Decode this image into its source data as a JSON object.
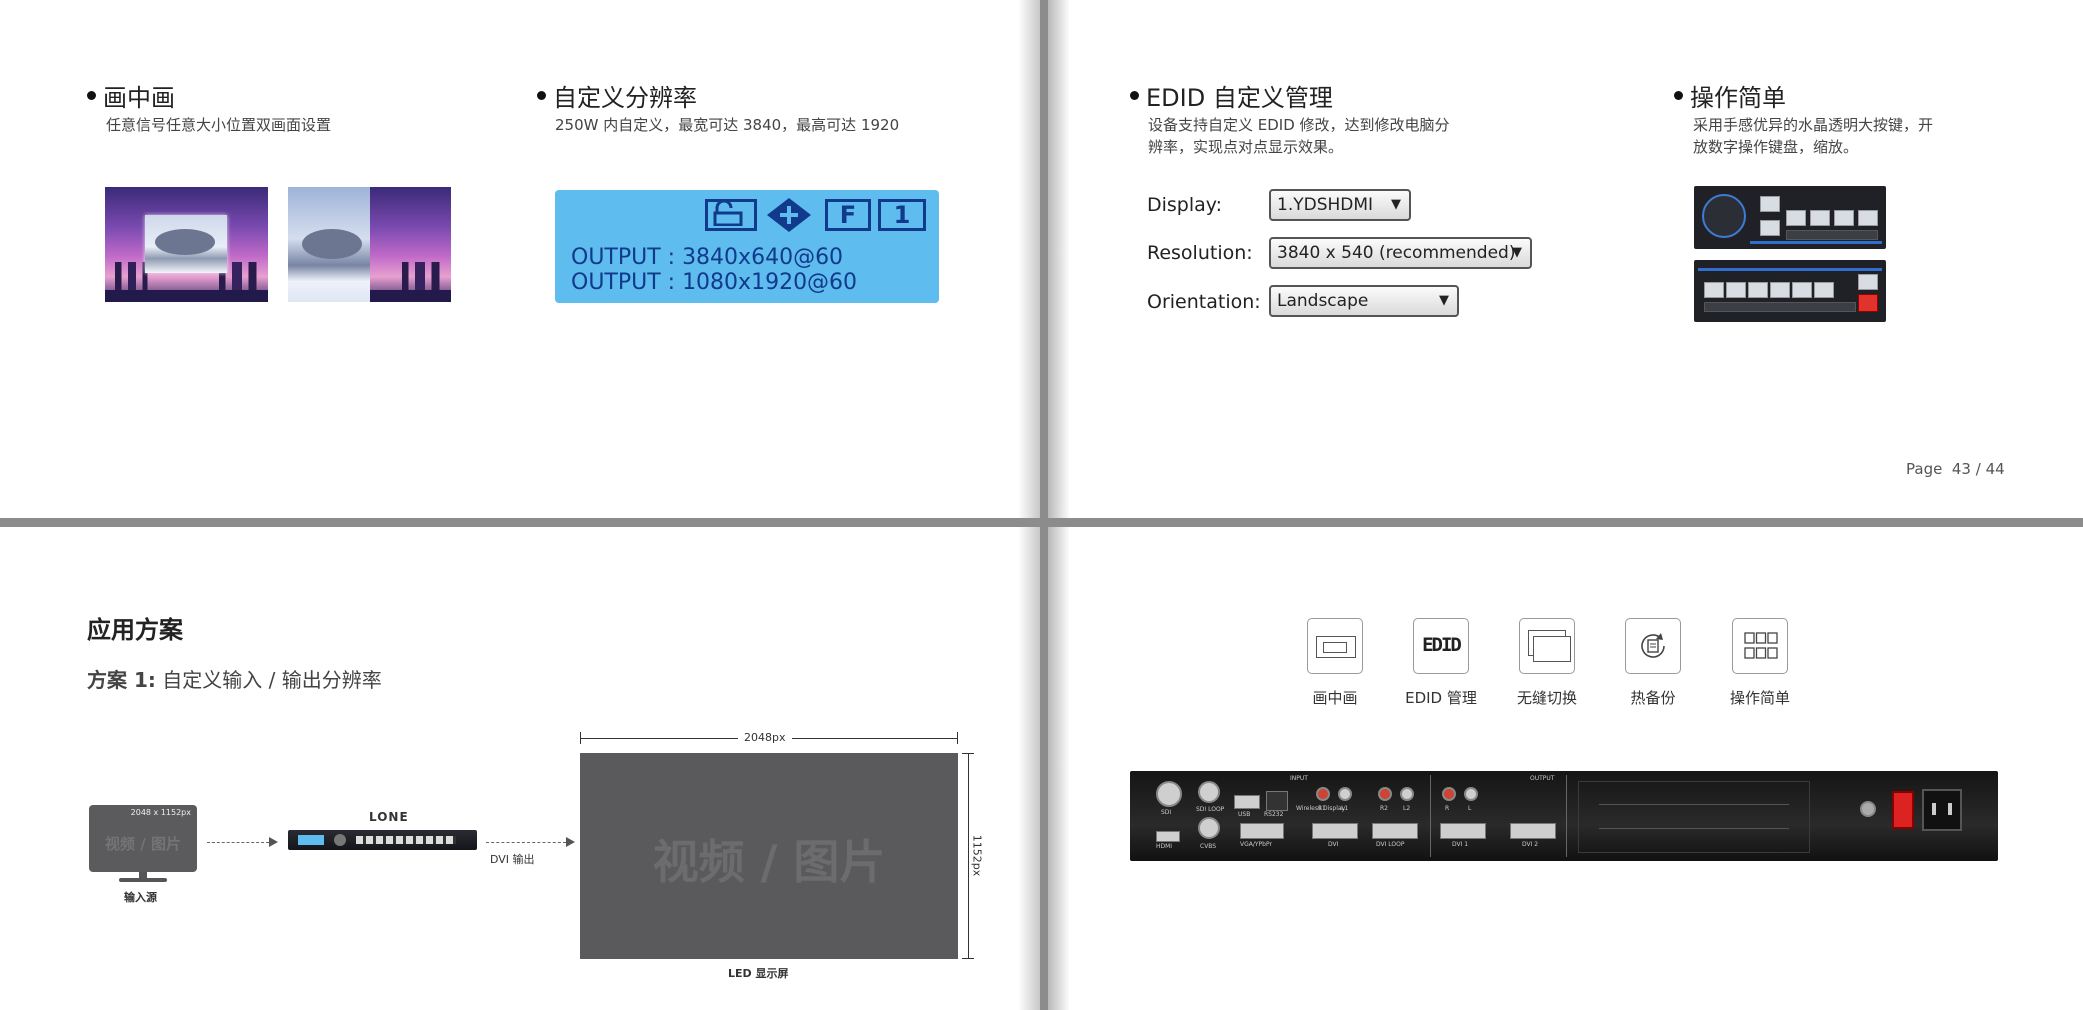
{
  "page_tl": {
    "pip": {
      "title": "画中画",
      "desc": "任意信号任意大小位置双画面设置"
    },
    "custom_res": {
      "title": "自定义分辨率",
      "desc": "250W 内自定义，最宽可达 3840，最高可达 1920",
      "lcd_icons": [
        "F",
        "1"
      ],
      "lcd_line1": "OUTPUT : 3840x640@60",
      "lcd_line2": "OUTPUT : 1080x1920@60"
    }
  },
  "page_tr": {
    "edid": {
      "title": "EDID 自定义管理",
      "desc1": "设备支持自定义 EDID 修改，达到修改电脑分",
      "desc2": "辨率，实现点对点显示效果。",
      "display_label": "Display:",
      "display_value": "1.YDSHDMI",
      "resolution_label": "Resolution:",
      "resolution_value": "3840 x 540 (recommended)",
      "orientation_label": "Orientation:",
      "orientation_value": "Landscape"
    },
    "simple": {
      "title": "操作简单",
      "desc1": "采用手感优异的水晶透明大按键，开",
      "desc2": "放数字操作键盘，缩放。"
    },
    "page_label": "Page",
    "page_current": "43",
    "page_sep": "/",
    "page_total": "44"
  },
  "page_bl": {
    "heading": "应用方案",
    "plan_label": "方案 1:",
    "plan_text": " 自定义输入 / 输出分辨率",
    "monitor_res": "2048 x 1152px",
    "monitor_text": "视频 / 图片",
    "input_label": "输入源",
    "device_brand": "LONE",
    "dvi_label": "DVI 输出",
    "width_dim": "2048px",
    "height_dim": "1152px",
    "led_text": "视频 / 图片",
    "led_label": "LED 显示屏"
  },
  "page_br": {
    "features": [
      {
        "label": "画中画",
        "icon": "pip-icon"
      },
      {
        "label": "EDID 管理",
        "icon": "edid-icon",
        "icon_text": "EDID"
      },
      {
        "label": "无缝切换",
        "icon": "seamless-switch-icon"
      },
      {
        "label": "热备份",
        "icon": "hot-backup-icon"
      },
      {
        "label": "操作简单",
        "icon": "grid-icon"
      }
    ],
    "rear_labels": [
      "SDI",
      "HDMI",
      "CVBS",
      "USB",
      "RS232",
      "VGA/YPbPr",
      "Wireless Display",
      "R1",
      "L1",
      "R2",
      "L2",
      "DVI",
      "DVI LOOP",
      "INPUT",
      "OUTPUT",
      "R",
      "L",
      "DVI 1",
      "DVI 2",
      "SDI LOOP"
    ]
  }
}
